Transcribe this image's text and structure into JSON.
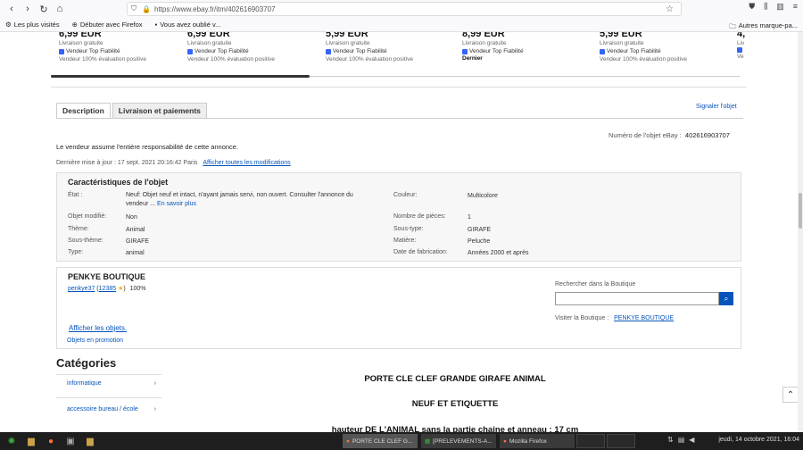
{
  "browser": {
    "url": "https://www.ebay.fr/itm/402616903707",
    "bookmarks": [
      "Les plus visités",
      "Débuter avec Firefox",
      "Vous avez oublié v..."
    ],
    "bookmarks_right": "Autres marque-pa..."
  },
  "products": [
    {
      "price": "6,99 EUR",
      "shipping": "Livraison gratuite",
      "top_rated": "Vendeur Top Fiabilité",
      "feedback": "Vendeur 100% évaluation positive"
    },
    {
      "price": "6,99 EUR",
      "shipping": "Livraison gratuite",
      "top_rated": "Vendeur Top Fiabilité",
      "feedback": "Vendeur 100% évaluation positive"
    },
    {
      "price": "5,99 EUR",
      "shipping": "Livraison gratuite",
      "top_rated": "Vendeur Top Fiabilité",
      "feedback": "Vendeur 100% évaluation positive"
    },
    {
      "price": "8,99 EUR",
      "shipping": "Livraison gratuite",
      "top_rated": "Vendeur Top Fiabilité",
      "feedback": "Dernier"
    },
    {
      "price": "5,99 EUR",
      "shipping": "Livraison gratuite",
      "top_rated": "Vendeur Top Fiabilité",
      "feedback": "Vendeur 100% évaluation positive"
    },
    {
      "price": "4,",
      "shipping": "Liv",
      "top_rated": "",
      "feedback": "Ve"
    }
  ],
  "tabs": [
    "Description",
    "Livraison et paiements"
  ],
  "report_link": "Signaler l'objet",
  "item_number_label": "Numéro de l'objet eBay :",
  "item_number": "402616903707",
  "responsibility": "Le vendeur assume l'entière responsabilité de cette annonce.",
  "last_update_label": "Dernière mise à jour :",
  "last_update": "17 sept. 2021 20:16:42 Paris",
  "last_update_link": "Afficher toutes les modifications",
  "specs": {
    "title": "Caractéristiques de l'objet",
    "etat_label": "État :",
    "etat_line1": "Neuf: Objet neuf et intact, n'ayant jamais servi, non ouvert. Consulter l'annonce du",
    "etat_line2": "vendeur ...",
    "etat_more": "En savoir plus",
    "rows_left": [
      {
        "label": "Objet modifié:",
        "value": "Non"
      },
      {
        "label": "Thème:",
        "value": "Animal"
      },
      {
        "label": "Sous-thème:",
        "value": "GIRAFE"
      },
      {
        "label": "Type:",
        "value": "animal"
      }
    ],
    "rows_right": [
      {
        "label": "Couleur:",
        "value": "Multicolore"
      },
      {
        "label": "Nombre de pièces:",
        "value": "1"
      },
      {
        "label": "Sous-type:",
        "value": "GIRAFE"
      },
      {
        "label": "Matière:",
        "value": "Peluche"
      },
      {
        "label": "Date de fabrication:",
        "value": "Années 2000 et après"
      }
    ]
  },
  "seller": {
    "name": "PENKYE BOUTIQUE",
    "user": "penkye37",
    "score": "12385",
    "percent": "100%",
    "search_label": "Rechercher dans la Boutique",
    "visit_label": "Visiter la Boutique :",
    "visit_link": "PENKYE BOUTIQUE",
    "show_items": "Afficher les objets.",
    "promo": "Objets en promotion"
  },
  "categories": {
    "title": "Catégories",
    "items": [
      "informatique",
      "accessoire bureau / école"
    ]
  },
  "description": [
    "PORTE CLE CLEF GRANDE GIRAFE ANIMAL",
    "NEUF ET ETIQUETTE",
    "hauteur DE L'ANIMAL sans la partie chaine et anneau : 17 cm"
  ],
  "taskbar": {
    "tasks": [
      "PORTE CLE CLEF G...",
      "[PRELEVEMENTS-A...",
      "Mozilla Firefox"
    ],
    "clock": "jeudi, 14 octobre 2021, 16:04"
  }
}
